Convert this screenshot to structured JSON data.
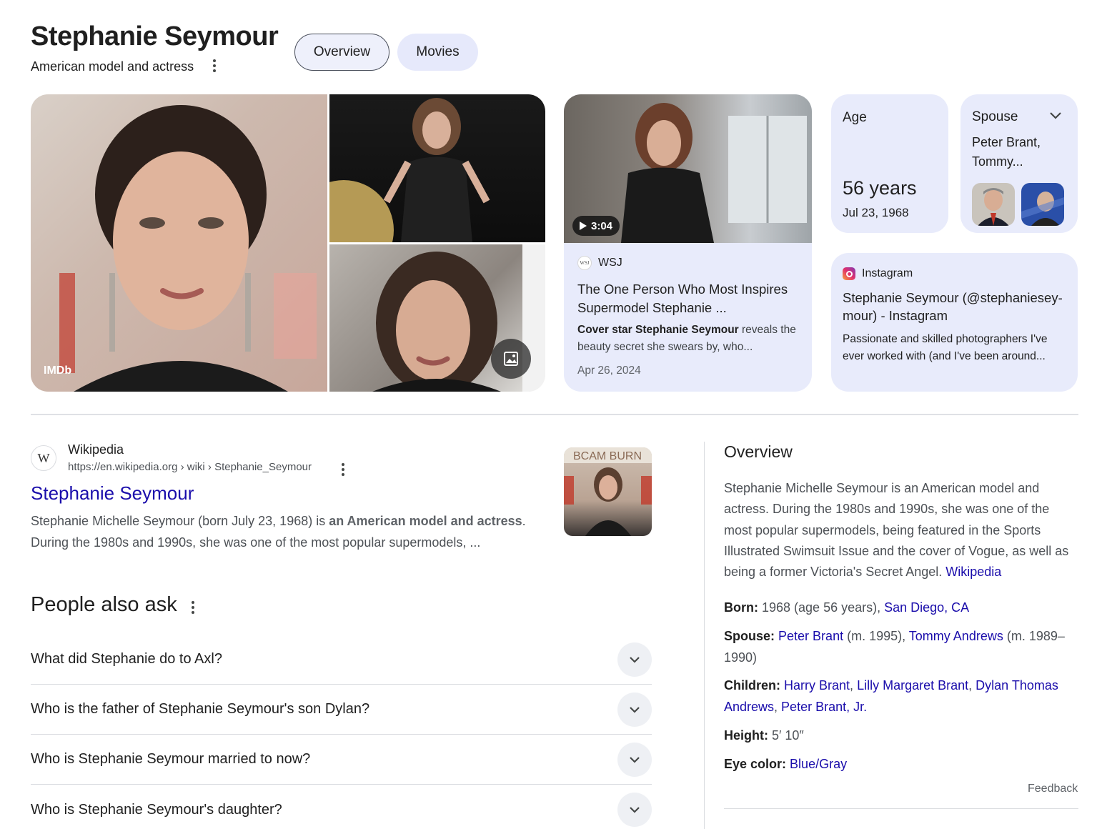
{
  "header": {
    "title": "Stephanie Seymour",
    "subtitle": "American model and actress",
    "tabs": [
      {
        "label": "Overview",
        "active": true
      },
      {
        "label": "Movies",
        "active": false
      }
    ]
  },
  "photos": {
    "main_source": "IMDb"
  },
  "video_card": {
    "duration": "3:04",
    "source": "WSJ",
    "source_icon_text": "WSJ",
    "title": "The One Person Who Most Inspires Supermodel Stephanie ...",
    "snippet_bold": "Cover star Stephanie Seymour",
    "snippet_rest": " reveals the beauty secret she swears by, who...",
    "date": "Apr 26, 2024"
  },
  "age_card": {
    "label": "Age",
    "value": "56 years",
    "date": "Jul 23, 1968"
  },
  "spouse_card": {
    "label": "Spouse",
    "names": "Peter Brant, Tommy..."
  },
  "instagram_card": {
    "source": "Instagram",
    "title": "Stephanie Seymour (@stephaniesey­mour) - Instagram",
    "snippet": "Passionate and skilled photographers I've ever worked with (and I've been around..."
  },
  "wiki_result": {
    "site_name": "Wikipedia",
    "icon_letter": "W",
    "url": "https://en.wikipedia.org › wiki › Stephanie_Seymour",
    "title": "Stephanie Seymour",
    "snippet_start": "Stephanie Michelle Seymour (born July 23, 1968) is ",
    "snippet_bold": "an American model and actress",
    "snippet_end": ". During the 1980s and 1990s, she was one of the most popular supermodels, ...",
    "thumb_text": "BCAM BURN"
  },
  "people_also_ask": {
    "title": "People also ask",
    "questions": [
      "What did Stephanie do to Axl?",
      "Who is the father of Stephanie Seymour's son Dylan?",
      "Who is Stephanie Seymour married to now?",
      "Who is Stephanie Seymour's daughter?"
    ]
  },
  "overview": {
    "title": "Overview",
    "description": "Stephanie Michelle Seymour is an American model and actress. During the 1980s and 1990s, she was one of the most popular supermodels, being featured in the Sports Illustrated Swimsuit Issue and the cover of Vogue, as well as being a former Victoria's Secret Angel. ",
    "description_link": "Wikipedia",
    "born": {
      "label": "Born:",
      "text": " 1968 (age 56 years), ",
      "link": "San Diego, CA"
    },
    "spouse": {
      "label": "Spouse:",
      "link1": "Peter Brant",
      "text1": " (m. 1995), ",
      "link2": "Tommy Andrews",
      "text2": " (m. 1989–1990)"
    },
    "children": {
      "label": "Children:",
      "links": [
        "Harry Brant",
        "Lilly Margaret Brant",
        "Dylan Thomas Andrews",
        "Peter Brant, Jr."
      ]
    },
    "height": {
      "label": "Height:",
      "text": " 5′ 10″"
    },
    "eye_color": {
      "label": "Eye color:",
      "link": "Blue/Gray"
    },
    "feedback": "Feedback"
  }
}
